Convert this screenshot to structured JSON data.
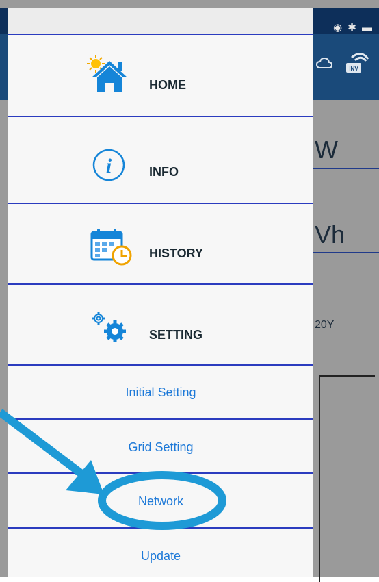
{
  "menu": {
    "items": [
      {
        "label": "HOME",
        "icon": "home-sun-icon"
      },
      {
        "label": "INFO",
        "icon": "info-icon"
      },
      {
        "label": "HISTORY",
        "icon": "calendar-clock-icon"
      },
      {
        "label": "SETTING",
        "icon": "gears-icon"
      }
    ],
    "subitems": [
      {
        "label": "Initial Setting"
      },
      {
        "label": "Grid Setting"
      },
      {
        "label": "Network"
      },
      {
        "label": "Update"
      }
    ]
  },
  "background": {
    "power_unit_partial": "W",
    "energy_unit_partial": "Vh",
    "model_partial": "20Y",
    "appbar_icon_label": "INV"
  },
  "colors": {
    "separator": "#2b3cbf",
    "accent_blue": "#1d79d8",
    "annotation": "#1e9ad6",
    "appbar": "#1a4a7a"
  }
}
